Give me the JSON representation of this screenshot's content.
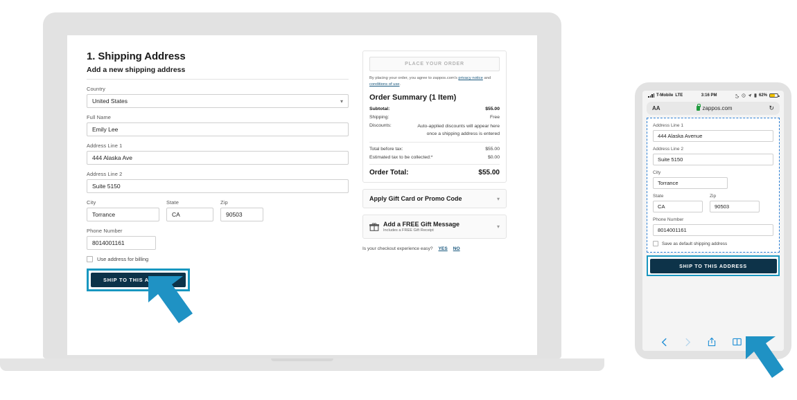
{
  "desktop": {
    "heading": "1. Shipping Address",
    "subheading": "Add a new shipping address",
    "fields": {
      "country_label": "Country",
      "country_value": "United States",
      "fullname_label": "Full Name",
      "fullname_value": "Emily Lee",
      "address1_label": "Address Line 1",
      "address1_value": "444 Alaska Ave",
      "address2_label": "Address Line 2",
      "address2_value": "Suite 5150",
      "city_label": "City",
      "city_value": "Torrance",
      "state_label": "State",
      "state_value": "CA",
      "zip_label": "Zip",
      "zip_value": "90503",
      "phone_label": "Phone Number",
      "phone_value": "8014001161"
    },
    "billing_checkbox_label": "Use address for billing",
    "ship_button_label": "SHIP TO THIS ADDRESS",
    "summary": {
      "place_order_label": "PLACE YOUR ORDER",
      "legal_prefix": "By placing your order, you agree to zappos.com's ",
      "legal_link1": "privacy notice",
      "legal_mid": " and ",
      "legal_link2": "conditions of use",
      "legal_suffix": ".",
      "title": "Order Summary (1 Item)",
      "subtotal_label": "Subtotal:",
      "subtotal_value": "$55.00",
      "shipping_label": "Shipping:",
      "shipping_value": "Free",
      "discounts_label": "Discounts:",
      "discounts_value": "Auto-applied discounts will appear here once a shipping address is entered",
      "before_tax_label": "Total before tax:",
      "before_tax_value": "$55.00",
      "tax_label": "Estimated tax to be collected:*",
      "tax_value": "$0.00",
      "total_label": "Order Total:",
      "total_value": "$55.00"
    },
    "promo_label": "Apply Gift Card or Promo Code",
    "gift_title": "Add a FREE Gift Message",
    "gift_sub": "Includes a FREE Gift Receipt",
    "feedback_question": "Is your checkout experience easy?",
    "feedback_yes": "YES",
    "feedback_no": "NO"
  },
  "mobile": {
    "status": {
      "carrier": "T-Mobile",
      "network": "LTE",
      "time": "3:16 PM",
      "battery": "62%"
    },
    "browser": {
      "text_size_label": "AA",
      "url": "zappos.com"
    },
    "fields": {
      "address1_label": "Address Line 1",
      "address1_value": "444 Alaska Avenue",
      "address2_label": "Address Line 2",
      "address2_value": "Suite 5150",
      "city_label": "City",
      "city_value": "Torrance",
      "state_label": "State",
      "state_value": "CA",
      "zip_label": "Zip",
      "zip_value": "90503",
      "phone_label": "Phone Number",
      "phone_value": "8014001161"
    },
    "default_checkbox_label": "Save as default shipping address",
    "ship_button_label": "SHIP TO THIS ADDRESS"
  },
  "colors": {
    "highlight": "#1897c0",
    "button_dark": "#0d3349",
    "dashed_outline": "#2b7fd4",
    "link": "#18577d",
    "battery": "#f2c300",
    "device_gray": "#e2e2e2"
  }
}
